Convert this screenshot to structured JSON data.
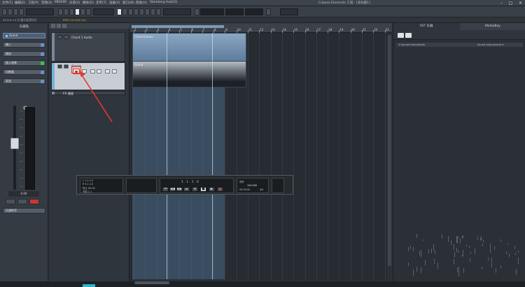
{
  "menubar": {
    "items": [
      "文件(F)",
      "编辑(E)",
      "工程(P)",
      "音频(A)",
      "MIDI(M)",
      "乐谱(S)",
      "媒体(D)",
      "走带(T)",
      "设备(V)",
      "窗口(W)",
      "帮助(H)",
      "Steinberg Hub(O)"
    ],
    "window_title": "Cubase Elements 工程 - [未标题1]"
  },
  "infoline": {
    "left": "48 kHz  24 位  最大录音时间",
    "tempo": "BPM 120.000  4/4"
  },
  "inspector": {
    "title": "乐器轨",
    "rows": [
      "Grand",
      "输入",
      "路由",
      "插入效果",
      "均衡器",
      "发送"
    ],
    "volume_readout": "0.00",
    "bottom_row": "乐谱符号"
  },
  "tracklist": {
    "track1_name": "Chord 1 Audio",
    "track2_name": "Grand",
    "track3_name": "FX 通道"
  },
  "ruler": {
    "ticks": [
      "1",
      "2",
      "3",
      "4",
      "5",
      "6",
      "7",
      "8",
      "9",
      "10",
      "11",
      "12",
      "13",
      "14",
      "15",
      "16",
      "17",
      "18",
      "19",
      "20",
      "21",
      "22",
      "23"
    ]
  },
  "clips": {
    "clip1_label": "Chord Events",
    "clip2_label": "Grand"
  },
  "transport": {
    "left_labels": [
      "L 1.1.1.0",
      "R 5.1.1.0",
      "停止 00:00",
      "节拍 1.1"
    ],
    "position": "1 . 1 . 1 . 0",
    "tempo": "120.000",
    "signature": "4/4",
    "sync": "同步",
    "time": "00:00:00"
  },
  "rightzone": {
    "tab_vst": "VST 乐器",
    "tab_media": "MediaBay",
    "header_left": "▾ Sound Instruments",
    "header_right": "Sound Instruments ▾"
  },
  "icons": {
    "close": "✕",
    "minimize": "–",
    "maximize": "□",
    "play": "▶",
    "stop": "■",
    "record": "●"
  }
}
